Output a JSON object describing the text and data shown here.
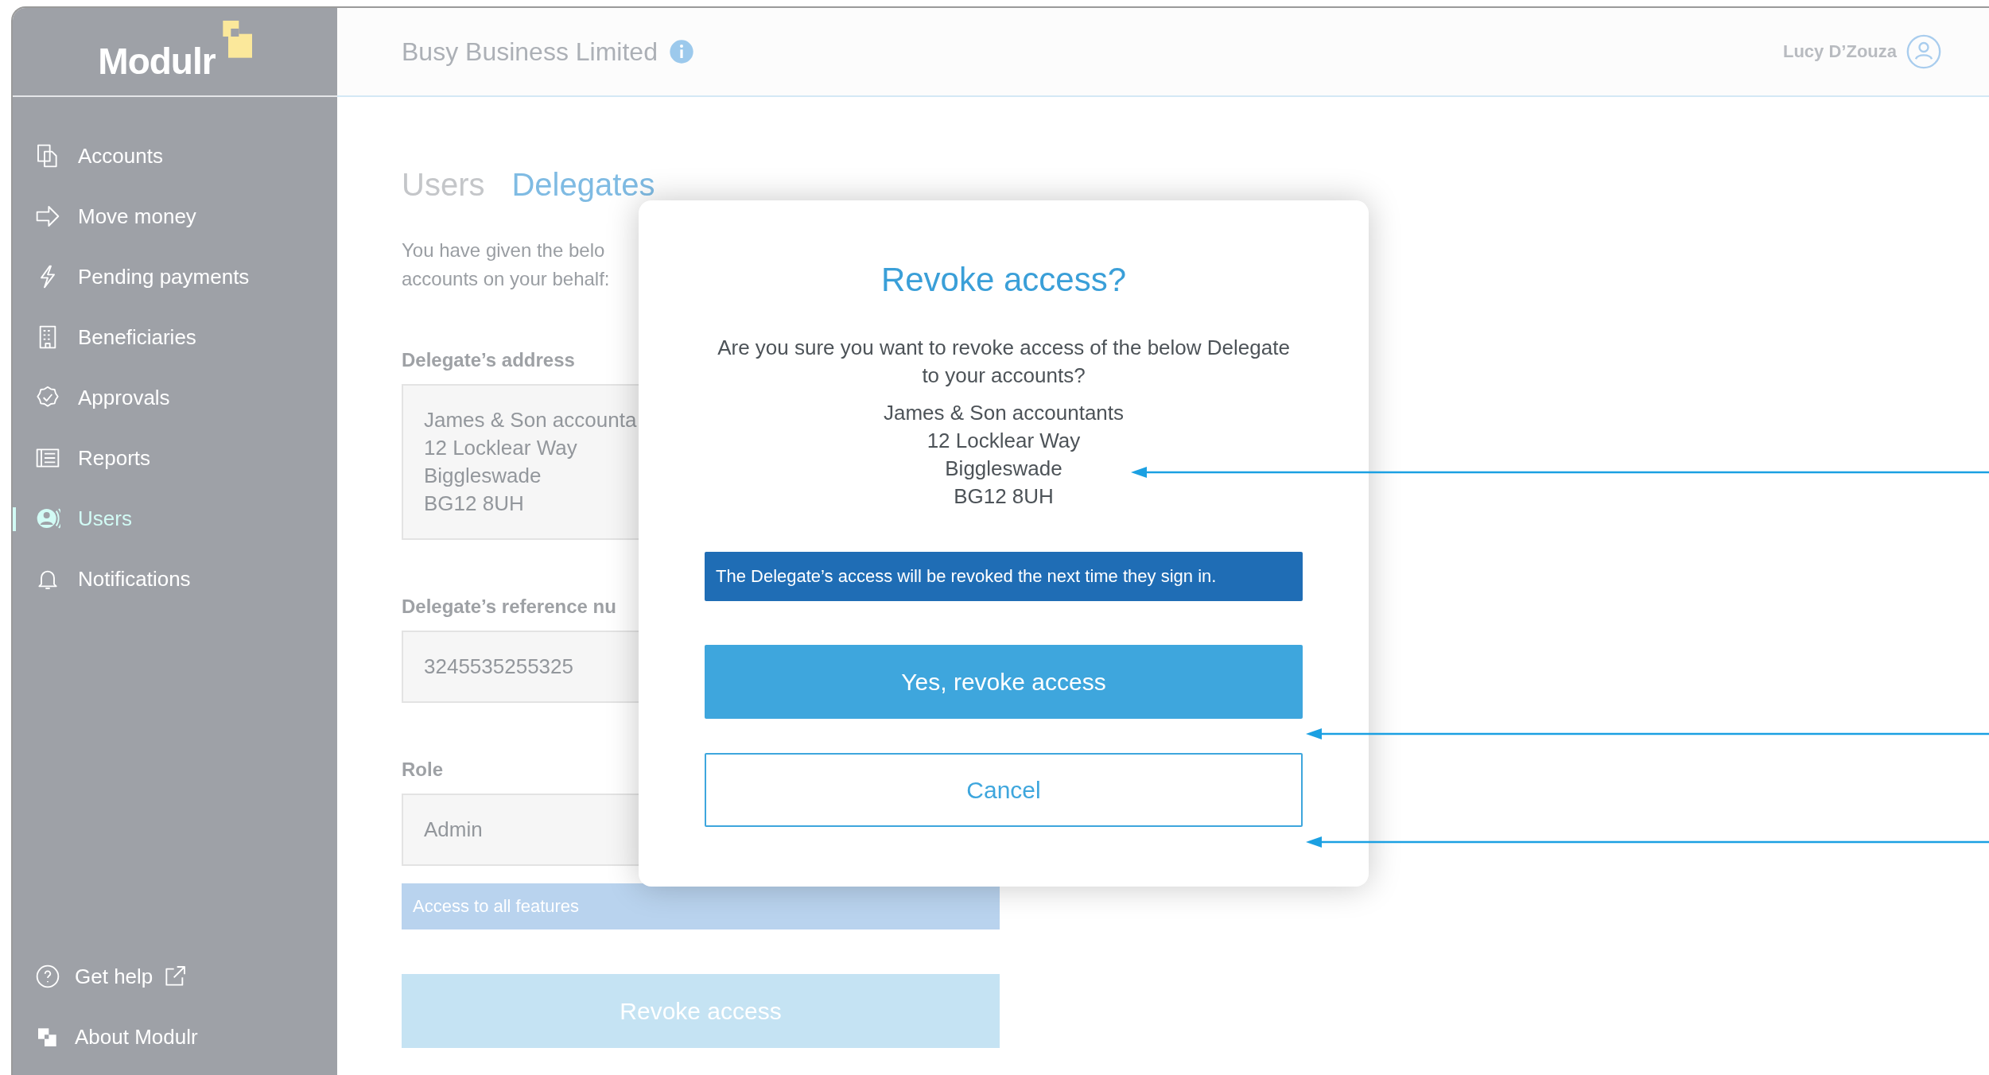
{
  "app": {
    "logo": "Modulr"
  },
  "sidebar": {
    "items": [
      {
        "label": "Accounts",
        "selected": false
      },
      {
        "label": "Move money",
        "selected": false
      },
      {
        "label": "Pending payments",
        "selected": false
      },
      {
        "label": "Beneficiaries",
        "selected": false
      },
      {
        "label": "Approvals",
        "selected": false
      },
      {
        "label": "Reports",
        "selected": false
      },
      {
        "label": "Users",
        "selected": true
      },
      {
        "label": "Notifications",
        "selected": false
      }
    ],
    "footer": [
      {
        "label": "Get help",
        "kind": "external"
      },
      {
        "label": "About Modulr",
        "kind": "about"
      }
    ]
  },
  "header": {
    "company": "Busy Business Limited",
    "user": "Lucy D’Zouza"
  },
  "tabs": [
    {
      "label": "Users",
      "selected": false
    },
    {
      "label": "Delegates",
      "selected": true
    }
  ],
  "intro": [
    "You have given the belo",
    "accounts on your behalf:"
  ],
  "fields": [
    {
      "label": "Delegate’s address",
      "lines": [
        "James & Son accounta",
        "12 Locklear Way",
        "Biggleswade",
        "BG12 8UH"
      ]
    },
    {
      "label": "Delegate’s reference nu",
      "lines": [
        "3245535255325"
      ]
    },
    {
      "label": "Role",
      "lines": [
        "Admin"
      ]
    }
  ],
  "role_note": "Access to all features",
  "revoke_button": "Revoke access",
  "dialog": {
    "title": "Revoke access?",
    "message": "Are you sure you want to revoke access of the below Delegate to your accounts?",
    "address": [
      "James & Son accountants",
      "12 Locklear Way",
      "Biggleswade",
      "BG12 8UH"
    ],
    "notice": "The Delegate’s access will be revoked the next time they sign in.",
    "confirm": "Yes, revoke access",
    "cancel": "Cancel"
  }
}
